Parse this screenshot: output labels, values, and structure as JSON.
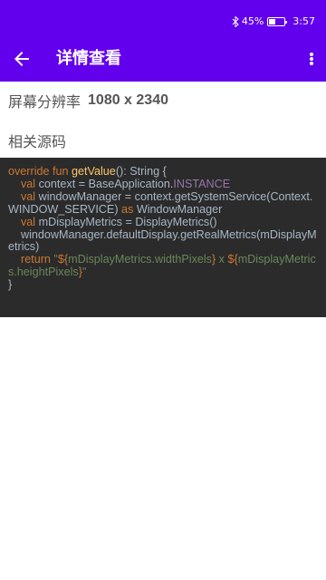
{
  "status_bar": {
    "battery": "45%",
    "battery_level": 0.45,
    "time": "3:57"
  },
  "app_bar": {
    "title": "详情查看",
    "back_icon": "arrow-back-icon",
    "more_icon": "more-vert-icon"
  },
  "resolution": {
    "label": "屏幕分辨率",
    "value": "1080 x 2340"
  },
  "source": {
    "heading": "相关源码",
    "code_lines": [
      "override fun getValue(): String {",
      "    val context = BaseApplication.INSTANCE",
      "    val windowManager = context.getSystemService(Context.WINDOW_SERVICE) as WindowManager",
      "    val mDisplayMetrics = DisplayMetrics()",
      "    windowManager.defaultDisplay.getRealMetrics(mDisplayMetrics)",
      "    return \"${mDisplayMetrics.widthPixels} x ${mDisplayMetrics.heightPixels}\"",
      "}"
    ]
  },
  "colors": {
    "primary": "#6200ee",
    "code_background": "#2b2b2b",
    "code_text": "#a9b7c6",
    "code_keyword": "#cc7832",
    "code_function": "#ffc66d",
    "code_constant": "#9876aa",
    "code_string": "#6a8759"
  }
}
